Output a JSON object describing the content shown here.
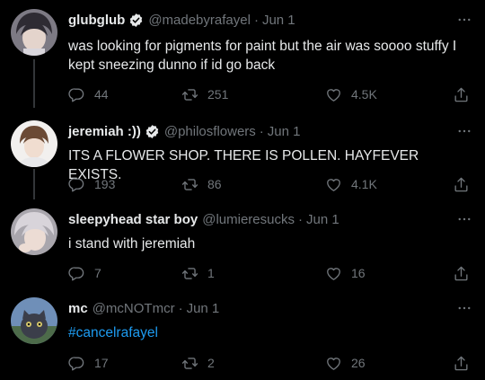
{
  "tweets": [
    {
      "name": "glubglub",
      "handle": "@madebyrafayel",
      "date": "Jun 1",
      "text": "was looking for pigments for paint but the air was soooo stuffy I kept sneezing dunno if id go back",
      "replies": "44",
      "retweets": "251",
      "likes": "4.5K"
    },
    {
      "name": "jeremiah :))",
      "handle": "@philosflowers",
      "date": "Jun 1",
      "text": "ITS A FLOWER SHOP. THERE IS POLLEN. HAYFEVER EXISTS.",
      "replies": "193",
      "retweets": "86",
      "likes": "4.1K"
    },
    {
      "name": "sleepyhead star boy",
      "handle": "@lumieresucks",
      "date": "Jun 1",
      "text": "i stand with jeremiah",
      "replies": "7",
      "retweets": "1",
      "likes": "16"
    },
    {
      "name": "mc",
      "handle": "@mcNOTmcr",
      "date": "Jun 1",
      "text": "#cancelrafayel",
      "replies": "17",
      "retweets": "2",
      "likes": "26"
    }
  ],
  "separator": "·",
  "colors": {
    "background": "#000000",
    "text": "#e7e9ea",
    "muted": "#71767b",
    "accent": "#1d9bf0",
    "verified_badge": "#e7e9ea"
  },
  "icons": [
    "more-icon",
    "verified-icon",
    "reply-icon",
    "retweet-icon",
    "like-icon",
    "share-icon"
  ]
}
